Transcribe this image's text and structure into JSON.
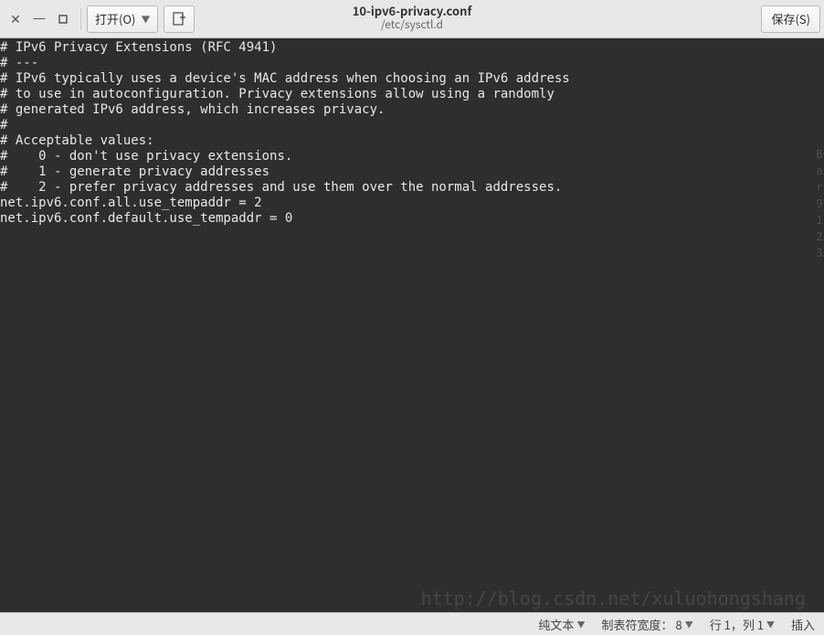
{
  "window": {
    "filename": "10-ipv6-privacy.conf",
    "filepath": "/etc/sysctl.d"
  },
  "toolbar": {
    "open_label": "打开(O)",
    "save_label": "保存(S)"
  },
  "editor": {
    "content": "# IPv6 Privacy Extensions (RFC 4941)\n# ---\n# IPv6 typically uses a device's MAC address when choosing an IPv6 address\n# to use in autoconfiguration. Privacy extensions allow using a randomly\n# generated IPv6 address, which increases privacy.\n#\n# Acceptable values:\n#    0 - don't use privacy extensions.\n#    1 - generate privacy addresses\n#    2 - prefer privacy addresses and use them over the normal addresses.\nnet.ipv6.conf.all.use_tempaddr = 2\nnet.ipv6.conf.default.use_tempaddr = 0"
  },
  "statusbar": {
    "syntax": "纯文本",
    "tabwidth_label": "制表符宽度：",
    "tabwidth_value": "8",
    "position_label": "行 1，列 1",
    "mode": "插入"
  },
  "gutter": {
    "marks": [
      "B",
      "a",
      "r",
      "9",
      "1",
      "",
      "",
      "2",
      "",
      "",
      "",
      "",
      "",
      "",
      "",
      "3"
    ]
  }
}
